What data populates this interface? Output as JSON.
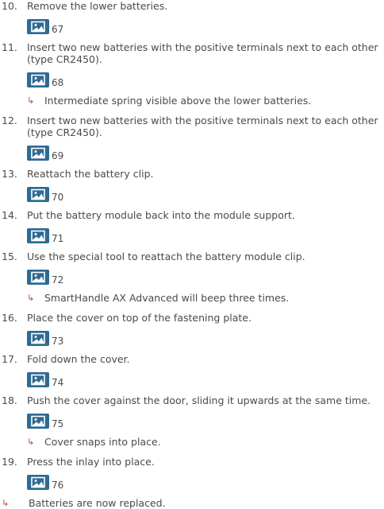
{
  "steps": [
    {
      "num": "10.",
      "text": "Remove the lower batteries.",
      "fig": "67"
    },
    {
      "num": "11.",
      "text": "Insert two new batteries with the positive terminals next to each other (type CR2450).",
      "fig": "68",
      "result": "Intermediate spring visible above the lower batteries."
    },
    {
      "num": "12.",
      "text": "Insert two new batteries with the positive terminals next to each other (type CR2450).",
      "fig": "69"
    },
    {
      "num": "13.",
      "text": "Reattach the battery clip.",
      "fig": "70"
    },
    {
      "num": "14.",
      "text": "Put the battery module back into the module support.",
      "fig": "71"
    },
    {
      "num": "15.",
      "text": "Use the special tool to reattach the battery module clip.",
      "fig": "72",
      "result": "SmartHandle AX Advanced will beep three times."
    },
    {
      "num": "16.",
      "text": "Place the cover on top of the fastening plate.",
      "fig": "73"
    },
    {
      "num": "17.",
      "text": "Fold down the cover.",
      "fig": "74"
    },
    {
      "num": "18.",
      "text": "Push the cover against the door, sliding it upwards at the same time.",
      "fig": "75",
      "result": "Cover snaps into place."
    },
    {
      "num": "19.",
      "text": "Press the inlay into place.",
      "fig": "76"
    }
  ],
  "final_result": "Batteries are now replaced.",
  "result_arrow": "↳",
  "colors": {
    "text": "#4a4a4a",
    "icon": "#2e6a93",
    "arrow": "#c8442c"
  }
}
